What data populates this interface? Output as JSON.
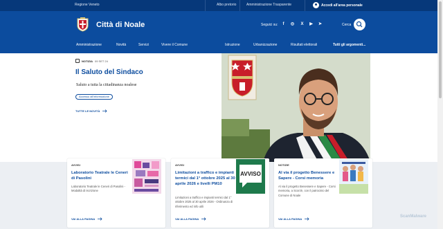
{
  "topbar": {
    "region": "Regione Veneto",
    "albo": "Albo pretorio",
    "amministrazione": "Amministrazione Trasparente",
    "login": "Accedi all'area personale"
  },
  "header": {
    "city_name": "Città di Noale",
    "follow_label": "Seguici su:",
    "search_label": "Cerca",
    "social": [
      {
        "icon": "facebook-icon",
        "glyph": "f"
      },
      {
        "icon": "instagram-icon",
        "glyph": "◎"
      },
      {
        "icon": "x-icon",
        "glyph": "X"
      },
      {
        "icon": "youtube-icon",
        "glyph": "▶"
      },
      {
        "icon": "telegram-icon",
        "glyph": "➤"
      }
    ]
  },
  "nav": {
    "items": [
      "Amministrazione",
      "Novità",
      "Servizi",
      "Vivere il Comune",
      "Istruzione",
      "Urbanizzazione",
      "Risultati elettorali",
      "Tutti gli argomenti..."
    ]
  },
  "hero": {
    "tag": "NOTIZIA",
    "date": "09 SET 24",
    "title": "Il Saluto del Sindaco",
    "subtitle": "Saluto a tutta la cittadinanza noalese",
    "pill": "Accesso all'informazione",
    "more": "TUTTE LE NOVITÀ"
  },
  "cards": [
    {
      "category": "AVVISI",
      "title": "Laboratorio Teatrale le Ceneri di Pasolini",
      "desc": "Laboratorio Teatrale le Ceneri di Pasolini - Modalità di iscrizione",
      "more": "VAI ALLA PAGINA"
    },
    {
      "category": "AVVISI",
      "title": "Limitazioni a traffico e impianti termici dal 1° ottobre 2025 al 30 aprile 2026 e livelli PM10",
      "desc": "Limitazioni a traffico e impianti termici dal 1° ottobre 2025 al 30 aprile 2026 - Ordinanza di riferimento ed info utili",
      "more": "VAI ALLA PAGINA",
      "image_text": "AVVISO"
    },
    {
      "category": "NOTIZIE",
      "title": "Al via il progetto Benessere e Sapere - Corsi memoria",
      "desc": "Al via il progetto Benessere e Sapere - Corsi memoria, a Scorzè, con il patrocinio del Comune di Noale",
      "more": "VAI ALLA PAGINA"
    }
  ],
  "watermark": "ScanMalware",
  "colors": {
    "topbar": "#06387a",
    "header": "#0c4c9e",
    "accent": "#0c4c9e",
    "cards_bg": "#eceff3",
    "avviso_green": "#1e7a4c"
  }
}
